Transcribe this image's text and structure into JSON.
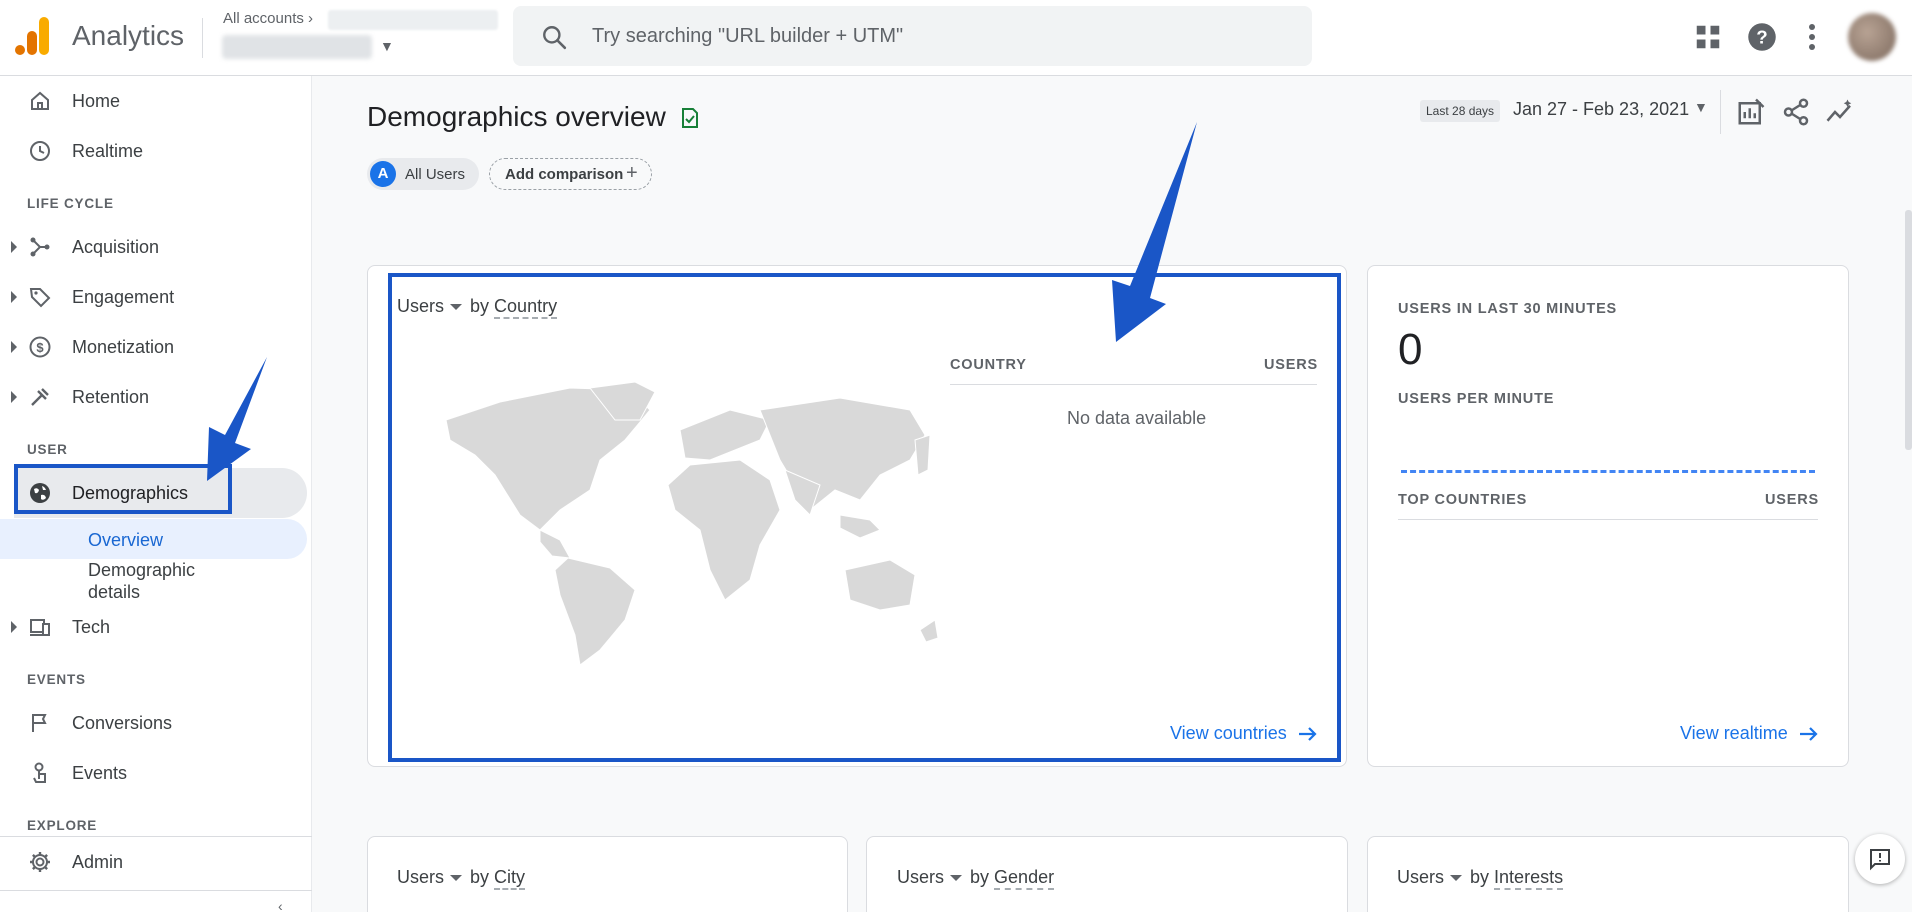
{
  "app": {
    "name": "Analytics",
    "account_crumb": "All accounts",
    "crumb_separator": "›",
    "search_placeholder": "Try searching \"URL builder + UTM\""
  },
  "sidebar": {
    "items_top": [
      {
        "label": "Home",
        "icon": "home-icon"
      },
      {
        "label": "Realtime",
        "icon": "clock-icon"
      }
    ],
    "sections": [
      {
        "title": "LIFE CYCLE",
        "items": [
          {
            "label": "Acquisition",
            "icon": "acquisition-icon"
          },
          {
            "label": "Engagement",
            "icon": "tag-icon"
          },
          {
            "label": "Monetization",
            "icon": "dollar-icon"
          },
          {
            "label": "Retention",
            "icon": "retention-icon"
          }
        ]
      },
      {
        "title": "USER",
        "items": [
          {
            "label": "Demographics",
            "icon": "globe-icon",
            "selected": true,
            "children": [
              {
                "label": "Overview",
                "selected": true
              },
              {
                "label": "Demographic details"
              }
            ]
          },
          {
            "label": "Tech",
            "icon": "devices-icon"
          }
        ]
      },
      {
        "title": "EVENTS",
        "items": [
          {
            "label": "Conversions",
            "icon": "flag-icon"
          },
          {
            "label": "Events",
            "icon": "touch-icon"
          }
        ]
      },
      {
        "title": "EXPLORE",
        "items": []
      }
    ],
    "footer": {
      "label": "Admin",
      "icon": "gear-icon"
    }
  },
  "main": {
    "title": "Demographics overview",
    "comparison": {
      "segment_letter": "A",
      "segment_label": "All Users",
      "add_label": "Add comparison"
    },
    "date": {
      "badge": "Last 28 days",
      "range": "Jan 27 - Feb 23, 2021"
    },
    "country_card": {
      "metric": "Users",
      "dimension_prefix": "by",
      "dimension": "Country",
      "col_country": "COUNTRY",
      "col_users": "USERS",
      "empty": "No data available",
      "link": "View countries"
    },
    "realtime_card": {
      "title": "USERS IN LAST 30 MINUTES",
      "value": "0",
      "per_minute": "USERS PER MINUTE",
      "col_countries": "TOP COUNTRIES",
      "col_users": "USERS",
      "link": "View realtime"
    },
    "bottom_cards": [
      {
        "metric": "Users",
        "prefix": "by",
        "dimension": "City"
      },
      {
        "metric": "Users",
        "prefix": "by",
        "dimension": "Gender"
      },
      {
        "metric": "Users",
        "prefix": "by",
        "dimension": "Interests"
      }
    ]
  },
  "colors": {
    "accent": "#1a73e8",
    "annotation": "#1a56c7",
    "logo_orange": "#f9ab00",
    "logo_dark": "#e37400",
    "verified": "#188038"
  }
}
